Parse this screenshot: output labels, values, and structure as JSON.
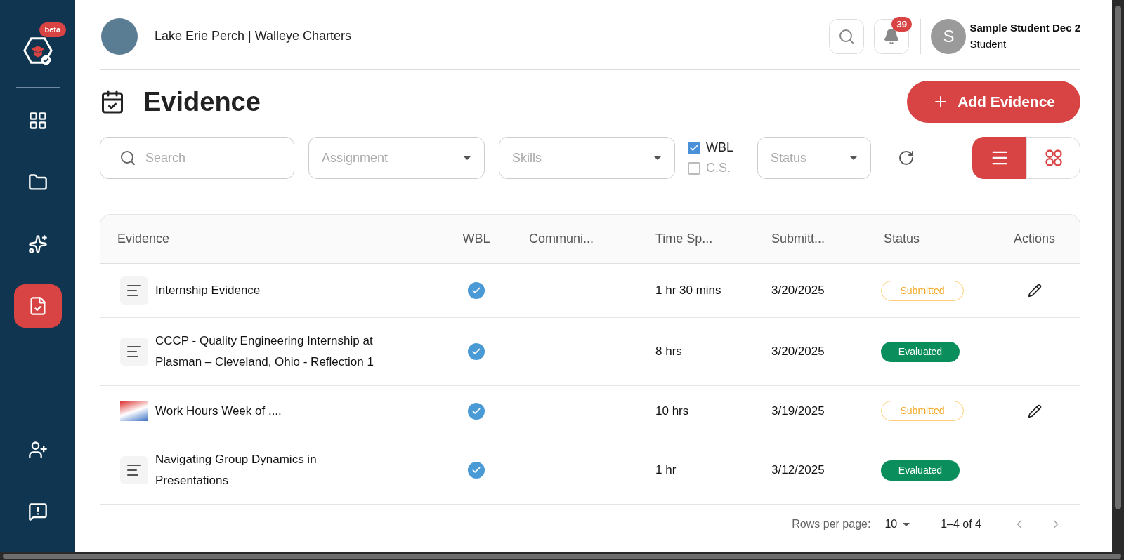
{
  "sidebar": {
    "logo_badge": "beta",
    "items": [
      {
        "kind": "dashboard",
        "selected": false
      },
      {
        "kind": "folder",
        "selected": false
      },
      {
        "kind": "insights",
        "selected": false
      },
      {
        "kind": "evidence",
        "selected": true
      }
    ],
    "bottom_items": [
      {
        "kind": "add-user"
      },
      {
        "kind": "feedback"
      }
    ]
  },
  "header": {
    "organization": "Lake Erie Perch | Walleye Charters",
    "notification_count": "39",
    "user": {
      "initial": "S",
      "name": "Sample Student Dec 2",
      "role": "Student"
    }
  },
  "page": {
    "title": "Evidence",
    "add_button": "Add Evidence"
  },
  "filters": {
    "search": {
      "placeholder": "Search"
    },
    "dropdowns": [
      {
        "placeholder": "Assignment"
      },
      {
        "placeholder": "Skills"
      }
    ],
    "checkboxes": [
      {
        "label": "WBL",
        "checked": true
      },
      {
        "label": "C.S.",
        "checked": false
      }
    ],
    "status": {
      "placeholder": "Status"
    },
    "views": [
      {
        "kind": "list",
        "selected": true
      },
      {
        "kind": "grid",
        "selected": false
      }
    ]
  },
  "table": {
    "columns": [
      "Evidence",
      "WBL",
      "Communi...",
      "Time Sp...",
      "Submitt...",
      "Status",
      "Actions"
    ],
    "rows": [
      {
        "kind": "document",
        "title": "Internship Evidence",
        "wbl": true,
        "time": "1 hr 30 mins",
        "submitted": "3/20/2025",
        "status": {
          "label": "Submitted",
          "kind": "submitted"
        },
        "editable": true
      },
      {
        "kind": "document",
        "title": "CCCP - Quality Engineering Internship at Plasman – Cleveland, Ohio - Reflection 1",
        "wbl": true,
        "time": "8 hrs",
        "submitted": "3/20/2025",
        "status": {
          "label": "Evaluated",
          "kind": "evaluated"
        },
        "editable": false
      },
      {
        "kind": "image",
        "title": "Work Hours Week of ....",
        "wbl": true,
        "time": "10 hrs",
        "submitted": "3/19/2025",
        "status": {
          "label": "Submitted",
          "kind": "submitted"
        },
        "editable": true
      },
      {
        "kind": "document",
        "title": "Navigating Group Dynamics in Presentations",
        "wbl": true,
        "time": "1 hr",
        "submitted": "3/12/2025",
        "status": {
          "label": "Evaluated",
          "kind": "evaluated"
        },
        "editable": false
      }
    ]
  },
  "pagination": {
    "rows_per_page_label": "Rows per page:",
    "rows_per_page": "10",
    "range": "1–4 of 4"
  }
}
